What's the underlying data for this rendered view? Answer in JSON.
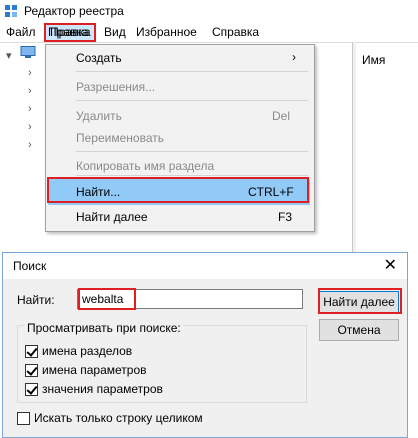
{
  "window": {
    "title": "Редактор реестра"
  },
  "menubar": [
    "Файл",
    "Правка",
    "Вид",
    "Избранное",
    "Справка"
  ],
  "right_pane": {
    "column_name": "Имя"
  },
  "edit_menu": {
    "items": [
      {
        "label": "Создать",
        "shortcut": "",
        "submenu": true,
        "disabled": false
      },
      {
        "label": "Разрешения...",
        "shortcut": "",
        "submenu": false,
        "disabled": true
      },
      {
        "label": "Удалить",
        "shortcut": "Del",
        "submenu": false,
        "disabled": true
      },
      {
        "label": "Переименовать",
        "shortcut": "",
        "submenu": false,
        "disabled": true
      },
      {
        "label": "Копировать имя раздела",
        "shortcut": "",
        "submenu": false,
        "disabled": true
      },
      {
        "label": "Найти...",
        "shortcut": "CTRL+F",
        "submenu": false,
        "disabled": false
      },
      {
        "label": "Найти далее",
        "shortcut": "F3",
        "submenu": false,
        "disabled": false
      }
    ]
  },
  "search_dialog": {
    "title": "Поиск",
    "find_label": "Найти:",
    "find_value": "webalta",
    "find_next_label": "Найти далее",
    "cancel_label": "Отмена",
    "group_label": "Просматривать при поиске:",
    "options": [
      {
        "label": "имена разделов",
        "checked": true
      },
      {
        "label": "имена параметров",
        "checked": true
      },
      {
        "label": "значения параметров",
        "checked": true
      }
    ],
    "whole_string_label": "Искать только строку целиком",
    "whole_string_checked": false
  },
  "colors": {
    "highlight": "#91c9f7",
    "annotation": "#e02020",
    "menu_bg": "#f2f2f2"
  }
}
